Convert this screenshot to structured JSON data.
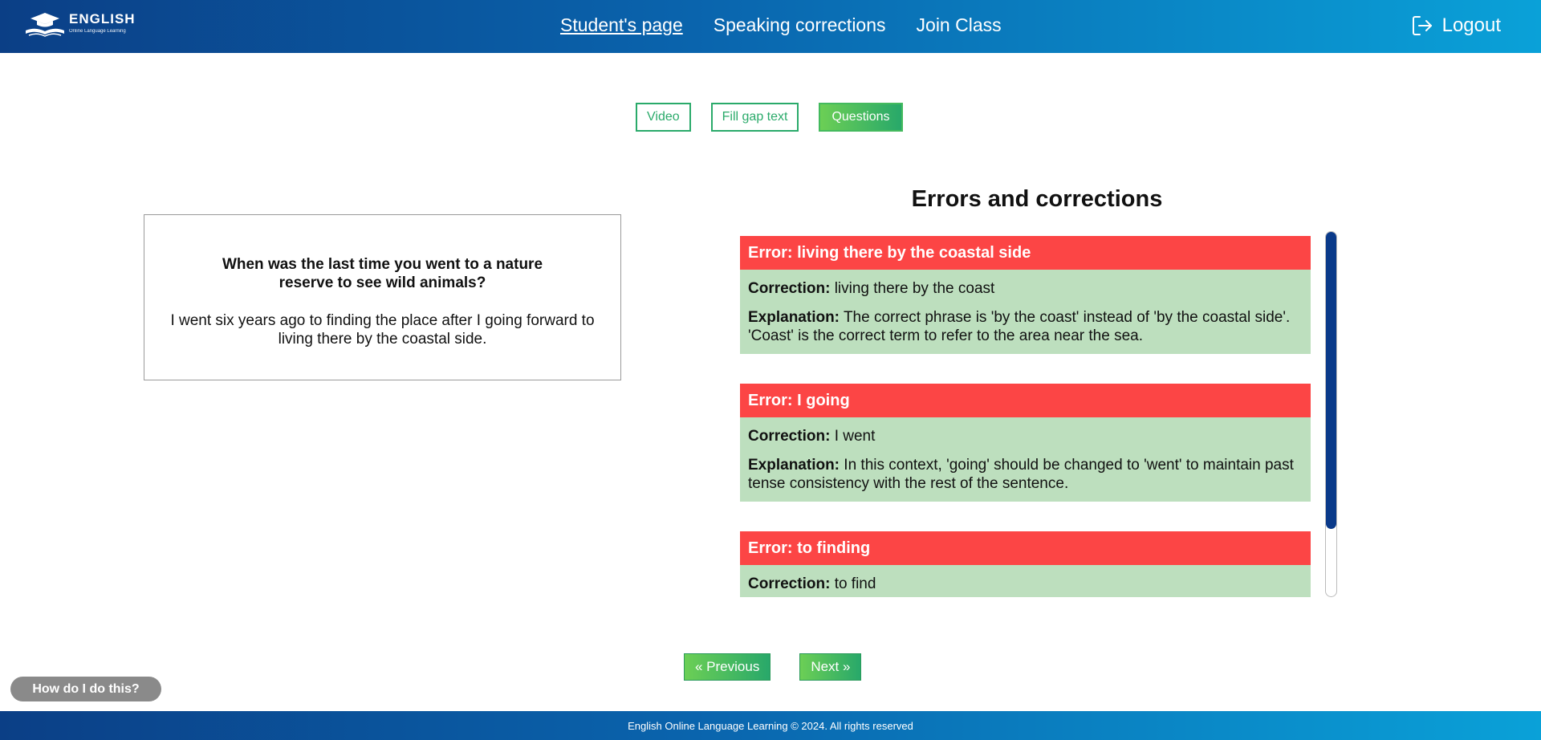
{
  "header": {
    "logo_title": "ENGLISH",
    "logo_subtitle": "Online Language Learning",
    "nav": [
      {
        "label": "Student's page",
        "active": true
      },
      {
        "label": "Speaking corrections",
        "active": false
      },
      {
        "label": "Join Class",
        "active": false
      }
    ],
    "logout_label": "Logout",
    "logout_icon": "logout-icon"
  },
  "tabs": [
    {
      "label": "Video",
      "active": false
    },
    {
      "label": "Fill gap text",
      "active": false
    },
    {
      "label": "Questions",
      "active": true
    }
  ],
  "question": {
    "title": "When was the last time you went to a nature reserve to see wild animals?",
    "answer": "I went six years ago to finding the place after I going forward to living there by the coastal side."
  },
  "errors_panel": {
    "title": "Errors and corrections",
    "correction_label": "Correction:",
    "explanation_label": "Explanation:",
    "items": [
      {
        "error": "Error: living there by the coastal side",
        "correction": "living there by the coast",
        "explanation": "The correct phrase is 'by the coast' instead of 'by the coastal side'. 'Coast' is the correct term to refer to the area near the sea."
      },
      {
        "error": "Error: I going",
        "correction": "I went",
        "explanation": "In this context, 'going' should be changed to 'went' to maintain past tense consistency with the rest of the sentence."
      },
      {
        "error": "Error: to finding",
        "correction": "to find",
        "explanation": ""
      }
    ]
  },
  "pager": {
    "previous_label": "« Previous",
    "next_label": "Next »"
  },
  "help_label": "How do I do this?",
  "footer": {
    "text": "English Online Language Learning © 2024. All rights reserved"
  },
  "colors": {
    "header_start": "#0b3f86",
    "header_end": "#0aa1d8",
    "accent_green": "#2aaa6a",
    "error_red": "#fc4545",
    "correction_green": "#bddfbe",
    "scroll_thumb": "#0a3a8a"
  }
}
